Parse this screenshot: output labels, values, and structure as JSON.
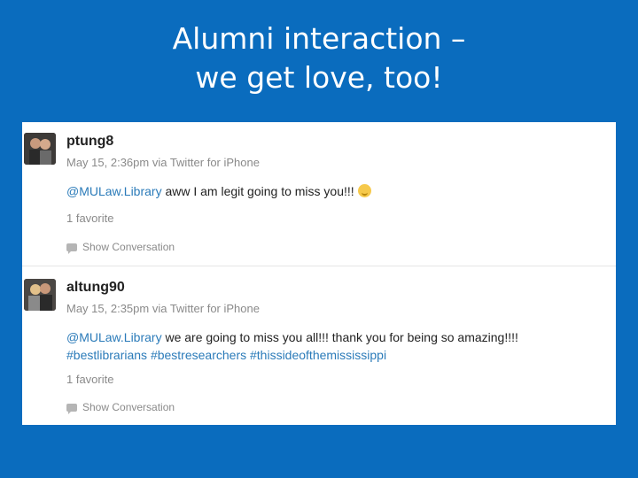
{
  "slide": {
    "title_line1": "Alumni interaction –",
    "title_line2": "we get love, too!"
  },
  "tweets": [
    {
      "username": "ptung8",
      "meta": "May 15, 2:36pm via Twitter for iPhone",
      "mention": "@MULaw.Library",
      "text": " aww I am legit going to miss you!!!",
      "hashtags": "",
      "favorites": "1 favorite",
      "show_conversation": "Show Conversation"
    },
    {
      "username": "altung90",
      "meta": "May 15, 2:35pm via Twitter for iPhone",
      "mention": "@MULaw.Library",
      "text": " we are going to miss you all!!! thank you for being so amazing!!!!",
      "hashtags": "#bestlibrarians #bestresearchers #thissideofthemississippi",
      "favorites": "1 favorite",
      "show_conversation": "Show Conversation"
    }
  ],
  "colors": {
    "background": "#0a6cbe",
    "link": "#2b7bb9",
    "muted": "#8a8a8a"
  },
  "icons": {
    "emoji": "smiling-face-icon",
    "conversation": "speech-bubble-icon"
  }
}
